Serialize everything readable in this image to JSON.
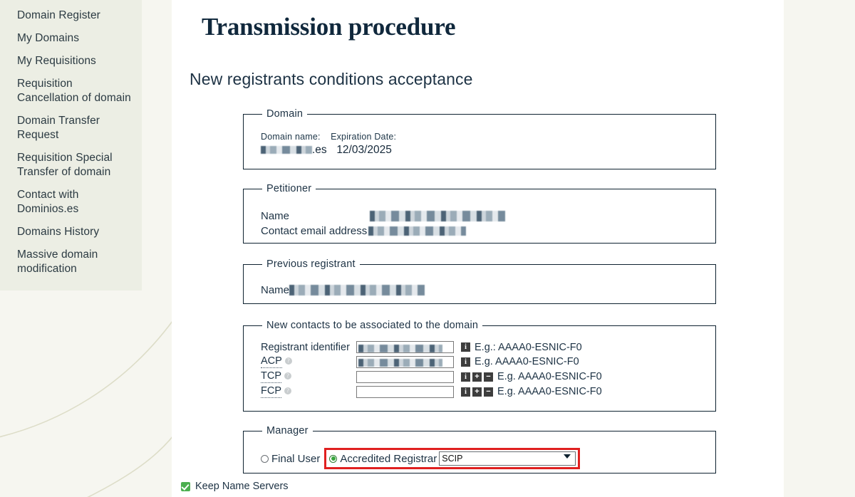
{
  "sidebar": {
    "items": [
      {
        "label": "Domain Register"
      },
      {
        "label": "My Domains"
      },
      {
        "label": "My Requisitions"
      },
      {
        "label": "Requisition Cancellation of domain"
      },
      {
        "label": "Domain Transfer Request"
      },
      {
        "label": "Requisition Special Transfer of domain"
      },
      {
        "label": "Contact with Dominios.es"
      },
      {
        "label": "Domains History"
      },
      {
        "label": "Massive domain modification"
      }
    ]
  },
  "page": {
    "title": "Transmission procedure",
    "subtitle": "New registrants conditions acceptance"
  },
  "domain_section": {
    "legend": "Domain",
    "label_domain_name": "Domain name:",
    "label_expiration_date": "Expiration Date:",
    "domain_suffix": ".es",
    "expiration_date": "12/03/2025"
  },
  "petitioner_section": {
    "legend": "Petitioner",
    "label_name": "Name",
    "label_contact_email": "Contact email address"
  },
  "previous_registrant_section": {
    "legend": "Previous registrant",
    "label_name": "Name"
  },
  "contacts_section": {
    "legend": "New contacts to be associated to the domain",
    "rows": [
      {
        "label": "Registrant identifier",
        "abbr": false,
        "help": false,
        "value_redacted": true,
        "has_add": false,
        "has_remove": false,
        "example": "E.g.: AAAA0-ESNIC-F0"
      },
      {
        "label": "ACP",
        "abbr": true,
        "help": true,
        "value_redacted": true,
        "has_add": false,
        "has_remove": false,
        "example": "E.g. AAAA0-ESNIC-F0"
      },
      {
        "label": "TCP",
        "abbr": true,
        "help": true,
        "value_redacted": false,
        "has_add": true,
        "has_remove": true,
        "example": "E.g. AAAA0-ESNIC-F0"
      },
      {
        "label": "FCP",
        "abbr": true,
        "help": true,
        "value_redacted": false,
        "has_add": true,
        "has_remove": true,
        "example": "E.g. AAAA0-ESNIC-F0"
      }
    ],
    "icons": {
      "info": "i",
      "add": "+",
      "remove": "−",
      "help": "?"
    }
  },
  "manager_section": {
    "legend": "Manager",
    "option_final_user": "Final User",
    "option_accredited_registrar": "Accredited Registrar",
    "selected_option": "accredited_registrar",
    "registrar_select_value": "SCIP",
    "highlight_color": "#e02020"
  },
  "footer": {
    "keep_name_servers_label": "Keep Name Servers",
    "keep_name_servers_checked": true,
    "checkbox_color": "#4caf50"
  }
}
